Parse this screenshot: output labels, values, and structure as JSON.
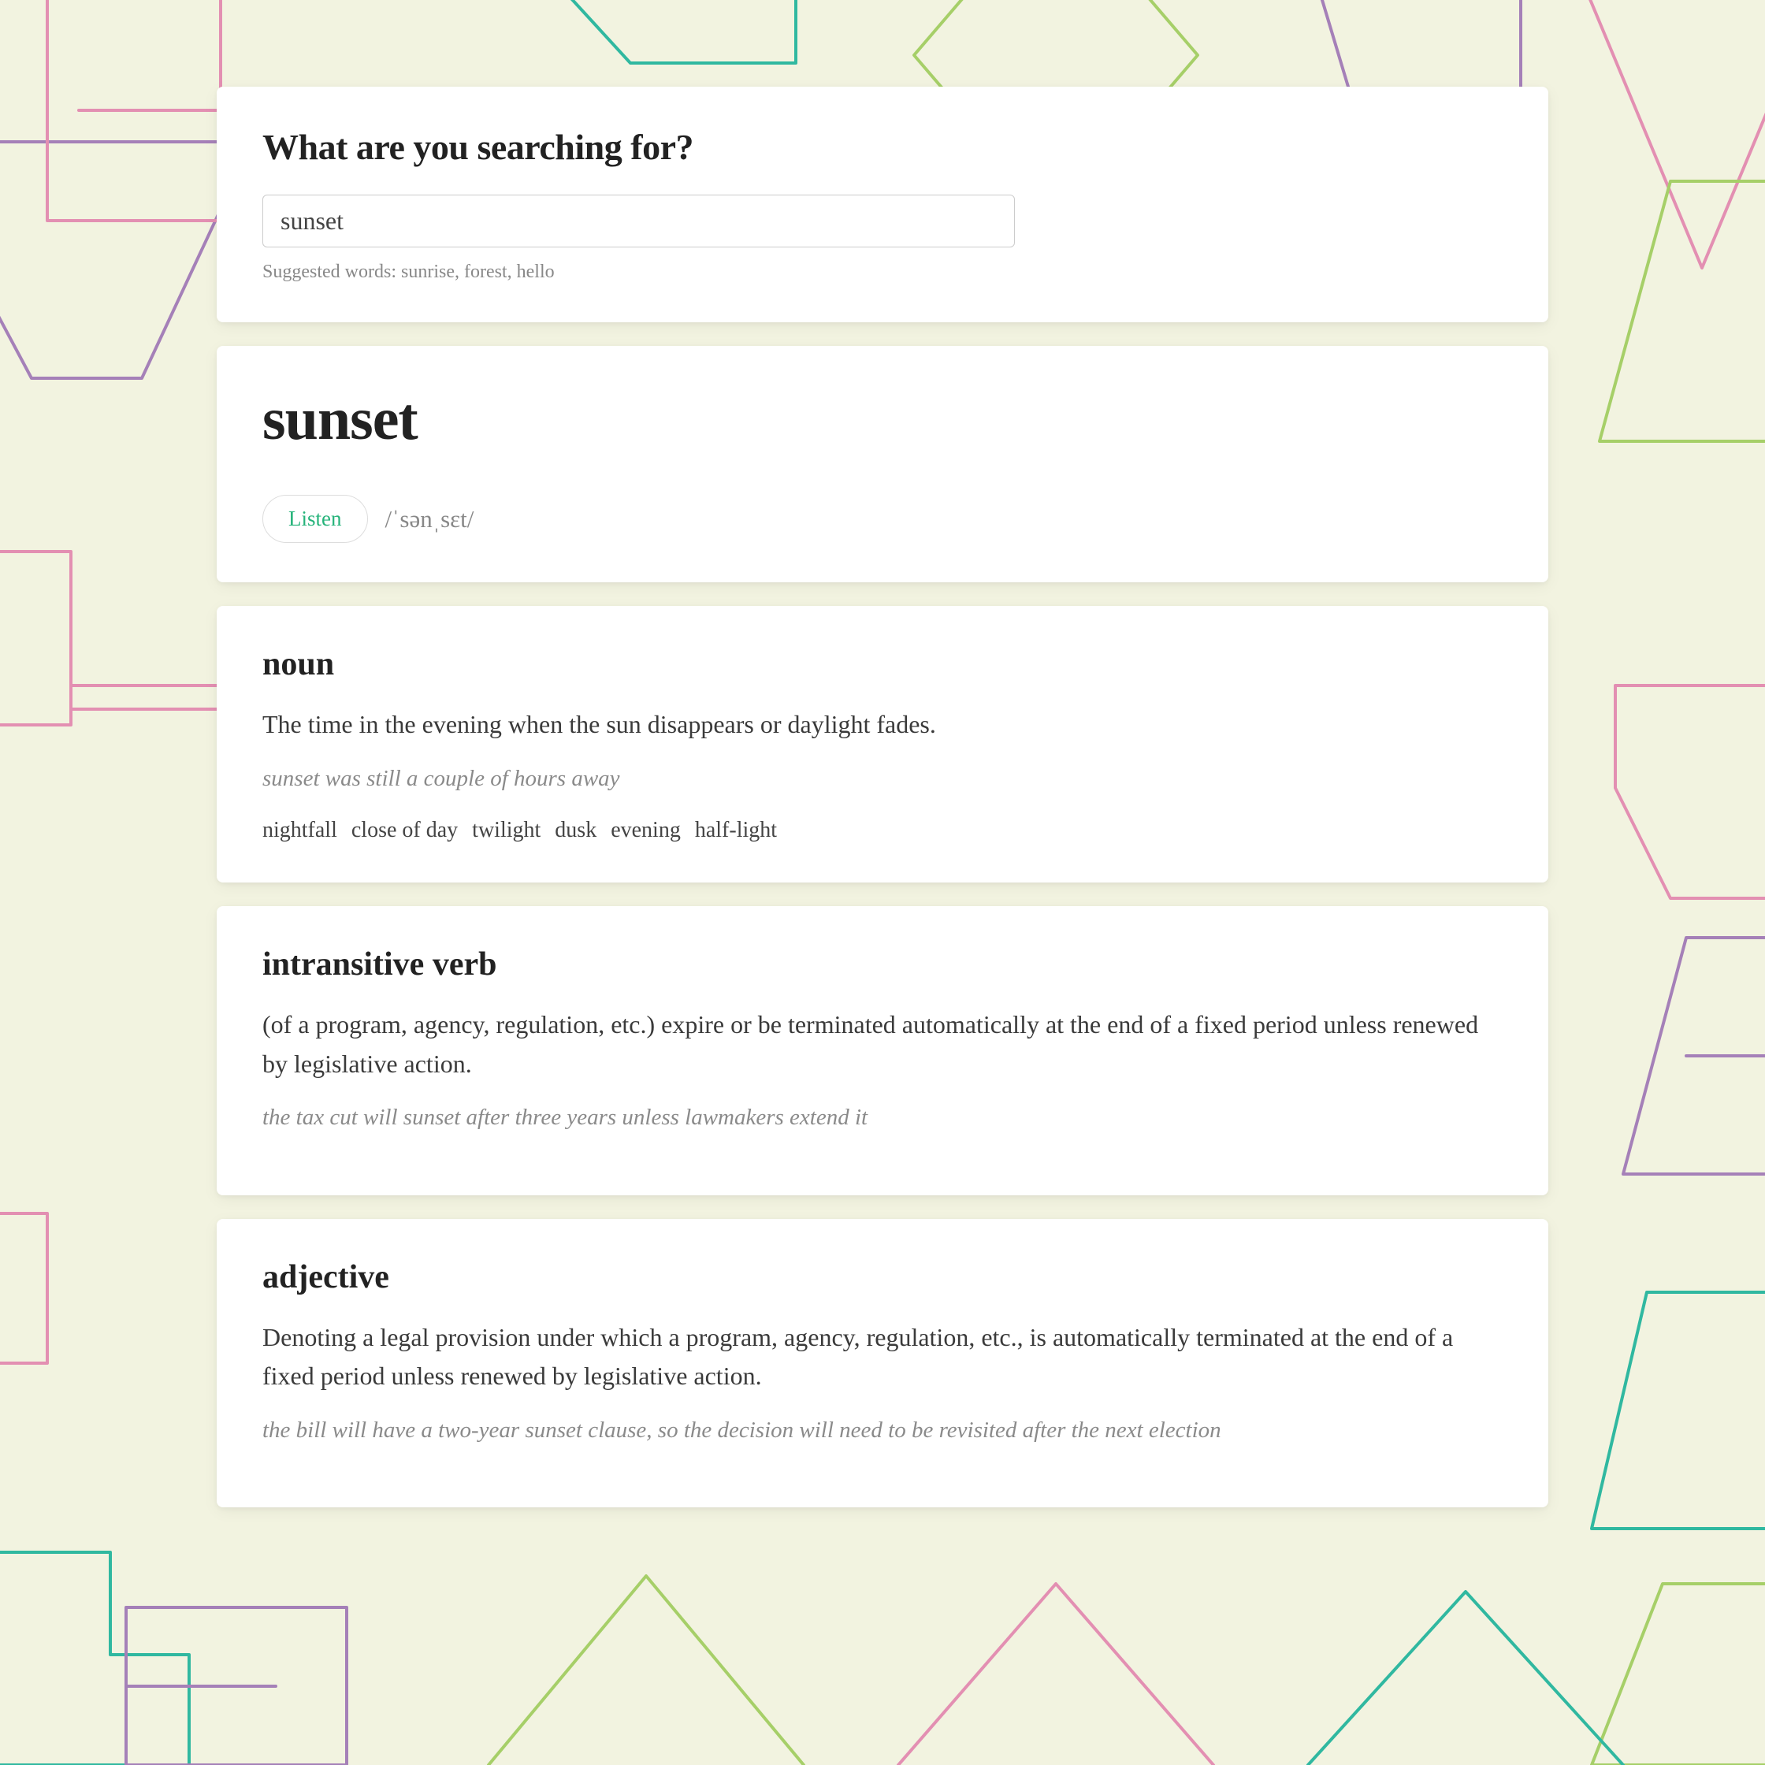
{
  "search": {
    "heading": "What are you searching for?",
    "value": "sunset",
    "suggested_line": "Suggested words: sunrise, forest, hello"
  },
  "word": {
    "title": "sunset",
    "listen_label": "Listen",
    "phonetic": "/ˈsənˌsɛt/"
  },
  "meanings": [
    {
      "pos": "noun",
      "definition": "The time in the evening when the sun disappears or daylight fades.",
      "example": "sunset was still a couple of hours away",
      "synonyms": [
        "nightfall",
        "close of day",
        "twilight",
        "dusk",
        "evening",
        "half-light"
      ]
    },
    {
      "pos": "intransitive verb",
      "definition": "(of a program, agency, regulation, etc.) expire or be terminated automatically at the end of a fixed period unless renewed by legislative action.",
      "example": "the tax cut will sunset after three years unless lawmakers extend it",
      "synonyms": []
    },
    {
      "pos": "adjective",
      "definition": "Denoting a legal provision under which a program, agency, regulation, etc., is automatically terminated at the end of a fixed period unless renewed by legislative action.",
      "example": "the bill will have a two-year sunset clause, so the decision will need to be revisited after the next election",
      "synonyms": []
    }
  ]
}
